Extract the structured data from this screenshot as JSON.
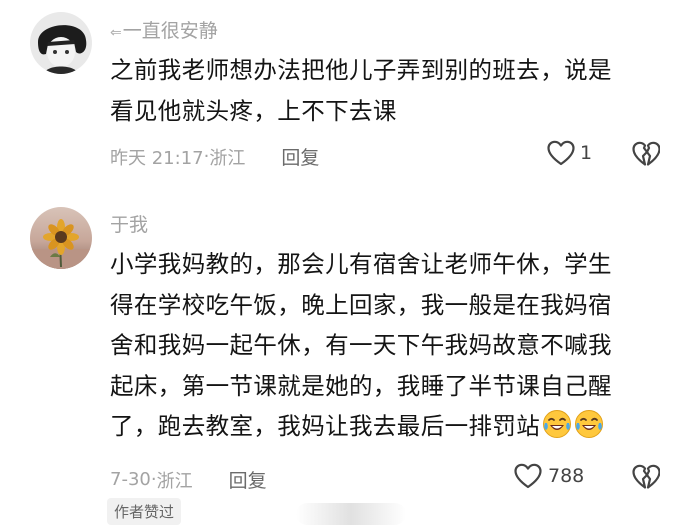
{
  "comments": [
    {
      "reply_prefix": "⇐",
      "username": "一直很安静",
      "lines": [
        "之前我老师想办法把他儿子弄到别的班去，说是",
        "看见他就头疼，上不下去课"
      ],
      "time": "昨天 21:17",
      "location": "浙江",
      "reply_label": "回复",
      "like_count": "1",
      "like_icon": "heart-outline-icon",
      "dislike_icon": "broken-heart-icon"
    },
    {
      "username": "于我",
      "lines": [
        "小学我妈教的，那会儿有宿舍让老师午休，学生",
        "得在学校吃午饭，晚上回家，我一般是在我妈宿",
        "舍和我妈一起午休，有一天下午我妈故意不喊我",
        "起床，第一节课就是她的，我睡了半节课自己醒",
        "了，跑去教室，我妈让我去最后一排罚站"
      ],
      "emoji": [
        "laughing-crying-emoji",
        "laughing-crying-emoji"
      ],
      "time": "7-30",
      "location": "浙江",
      "reply_label": "回复",
      "like_count": "788",
      "like_icon": "heart-outline-icon",
      "dislike_icon": "broken-heart-icon",
      "badge": "作者赞过"
    }
  ],
  "separator": " · "
}
